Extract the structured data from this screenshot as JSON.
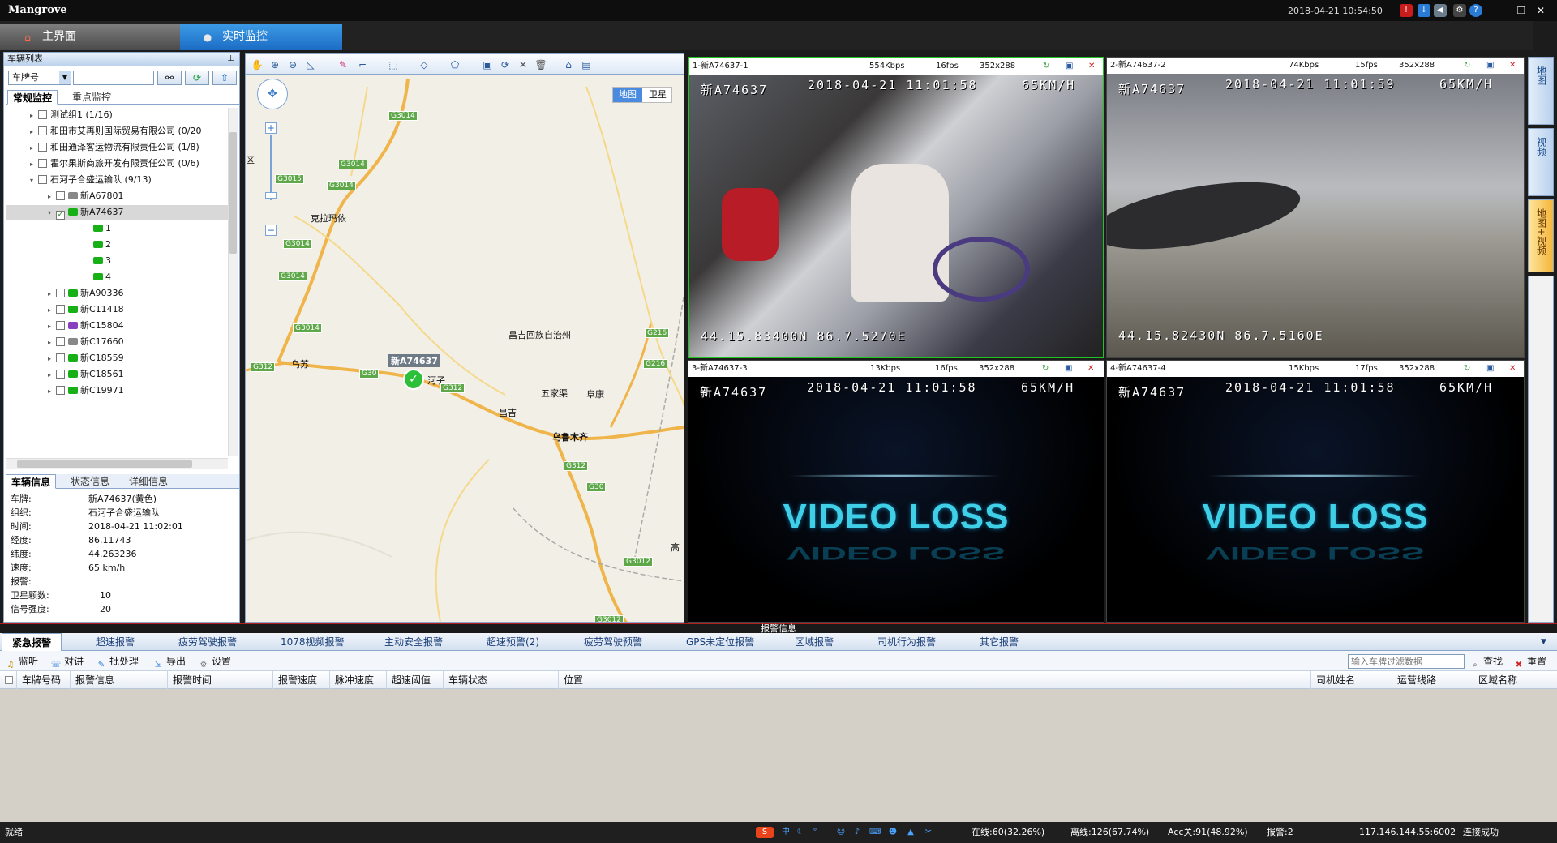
{
  "app": {
    "title": "Mangrove",
    "datetime": "2018-04-21 10:54:50"
  },
  "main_tabs": [
    {
      "label": "主界面",
      "icon": "home-icon"
    },
    {
      "label": "实时监控",
      "icon": "monitor-icon"
    }
  ],
  "vehicle_list": {
    "title": "车辆列表",
    "search_type": "车牌号",
    "search_value": "",
    "tabs": [
      "常规监控",
      "重点监控"
    ],
    "tree": [
      {
        "label": "测试组1",
        "count": "(1/16)"
      },
      {
        "label": "和田市艾再则国际贸易有限公司",
        "count": "(0/20"
      },
      {
        "label": "和田通泽客运物流有限责任公司",
        "count": "(1/8)"
      },
      {
        "label": "霍尔果斯商旅开发有限责任公司",
        "count": "(0/6)"
      },
      {
        "label": "石河子合盛运输队",
        "count": "(9/13)"
      },
      {
        "label": "新A67801"
      },
      {
        "label": "新A74637"
      },
      {
        "label": "1"
      },
      {
        "label": "2"
      },
      {
        "label": "3"
      },
      {
        "label": "4"
      },
      {
        "label": "新A90336"
      },
      {
        "label": "新C11418"
      },
      {
        "label": "新C15804"
      },
      {
        "label": "新C17660"
      },
      {
        "label": "新C18559"
      },
      {
        "label": "新C18561"
      },
      {
        "label": "新C19971"
      }
    ]
  },
  "vehicle_info": {
    "tabs": [
      "车辆信息",
      "状态信息",
      "详细信息"
    ],
    "rows": [
      {
        "k": "车牌:",
        "v": "新A74637(黄色)"
      },
      {
        "k": "组织:",
        "v": "石河子合盛运输队"
      },
      {
        "k": "时间:",
        "v": "2018-04-21 11:02:01"
      },
      {
        "k": "经度:",
        "v": "86.11743"
      },
      {
        "k": "纬度:",
        "v": "44.263236"
      },
      {
        "k": "速度:",
        "v": "65  km/h"
      },
      {
        "k": "报警:",
        "v": ""
      },
      {
        "k": "卫星颗数:",
        "v": "10"
      },
      {
        "k": "信号强度:",
        "v": "20"
      }
    ]
  },
  "map": {
    "mode_buttons": [
      "地图",
      "卫星"
    ],
    "labels": [
      "克拉玛依",
      "昌吉回族自治州",
      "乌苏",
      "河子",
      "昌吉",
      "五家渠",
      "阜康",
      "乌鲁木齐",
      "高",
      "区"
    ],
    "road_labels": [
      "G3014",
      "G3014",
      "G3014",
      "G3015",
      "G3014",
      "G3014",
      "G3014",
      "G312",
      "G30",
      "G312",
      "G216",
      "G216",
      "G312",
      "G30",
      "G3012",
      "G3012"
    ],
    "marker_label": "新A74637"
  },
  "videos": [
    {
      "title": "1-新A74637-1",
      "rate": "554Kbps",
      "fps": "16fps",
      "res": "352x288",
      "osd_plate": "新A74637",
      "osd_time": "2018-04-21  11:01:58",
      "osd_speed": "65KM/H",
      "osd_coord": "44.15.83400N 86.7.5270E"
    },
    {
      "title": "2-新A74637-2",
      "rate": "74Kbps",
      "fps": "15fps",
      "res": "352x288",
      "osd_plate": "新A74637",
      "osd_time": "2018-04-21  11:01:59",
      "osd_speed": "65KM/H",
      "osd_coord": "44.15.82430N 86.7.5160E"
    },
    {
      "title": "3-新A74637-3",
      "rate": "13Kbps",
      "fps": "16fps",
      "res": "352x288",
      "osd_plate": "新A74637",
      "osd_time": "2018-04-21  11:01:58",
      "osd_speed": "65KM/H",
      "loss": "VIDEO LOSS"
    },
    {
      "title": "4-新A74637-4",
      "rate": "15Kbps",
      "fps": "17fps",
      "res": "352x288",
      "osd_plate": "新A74637",
      "osd_time": "2018-04-21  11:01:58",
      "osd_speed": "65KM/H",
      "loss": "VIDEO LOSS"
    }
  ],
  "side_tabs": [
    "地图",
    "视频",
    "地图+视频"
  ],
  "alarm": {
    "header": "报警信息",
    "tabs": [
      "紧急报警",
      "超速报警",
      "疲劳驾驶报警",
      "1078视频报警",
      "主动安全报警",
      "超速预警(2)",
      "疲劳驾驶预警",
      "GPS未定位报警",
      "区域报警",
      "司机行为报警",
      "其它报警"
    ],
    "toolbar": [
      "监听",
      "对讲",
      "批处理",
      "导出",
      "设置"
    ],
    "filter_placeholder": "输入车牌过滤数据",
    "search_label": "查找",
    "reset_label": "重置",
    "columns": [
      "车牌号码",
      "报警信息",
      "报警时间",
      "报警速度",
      "脉冲速度",
      "超速阈值",
      "车辆状态",
      "位置",
      "司机姓名",
      "运营线路",
      "区域名称"
    ]
  },
  "status": {
    "ready": "就绪",
    "online": "在线:60(32.26%)",
    "offline": "离线:126(67.74%)",
    "acc": "Acc关:91(48.92%)",
    "alarm": "报警:2",
    "server": "117.146.144.55:6002",
    "conn": "连接成功"
  },
  "colors": {
    "accent": "#1b6cc4",
    "active_border": "#22c322",
    "alarm_red": "#b02020"
  }
}
